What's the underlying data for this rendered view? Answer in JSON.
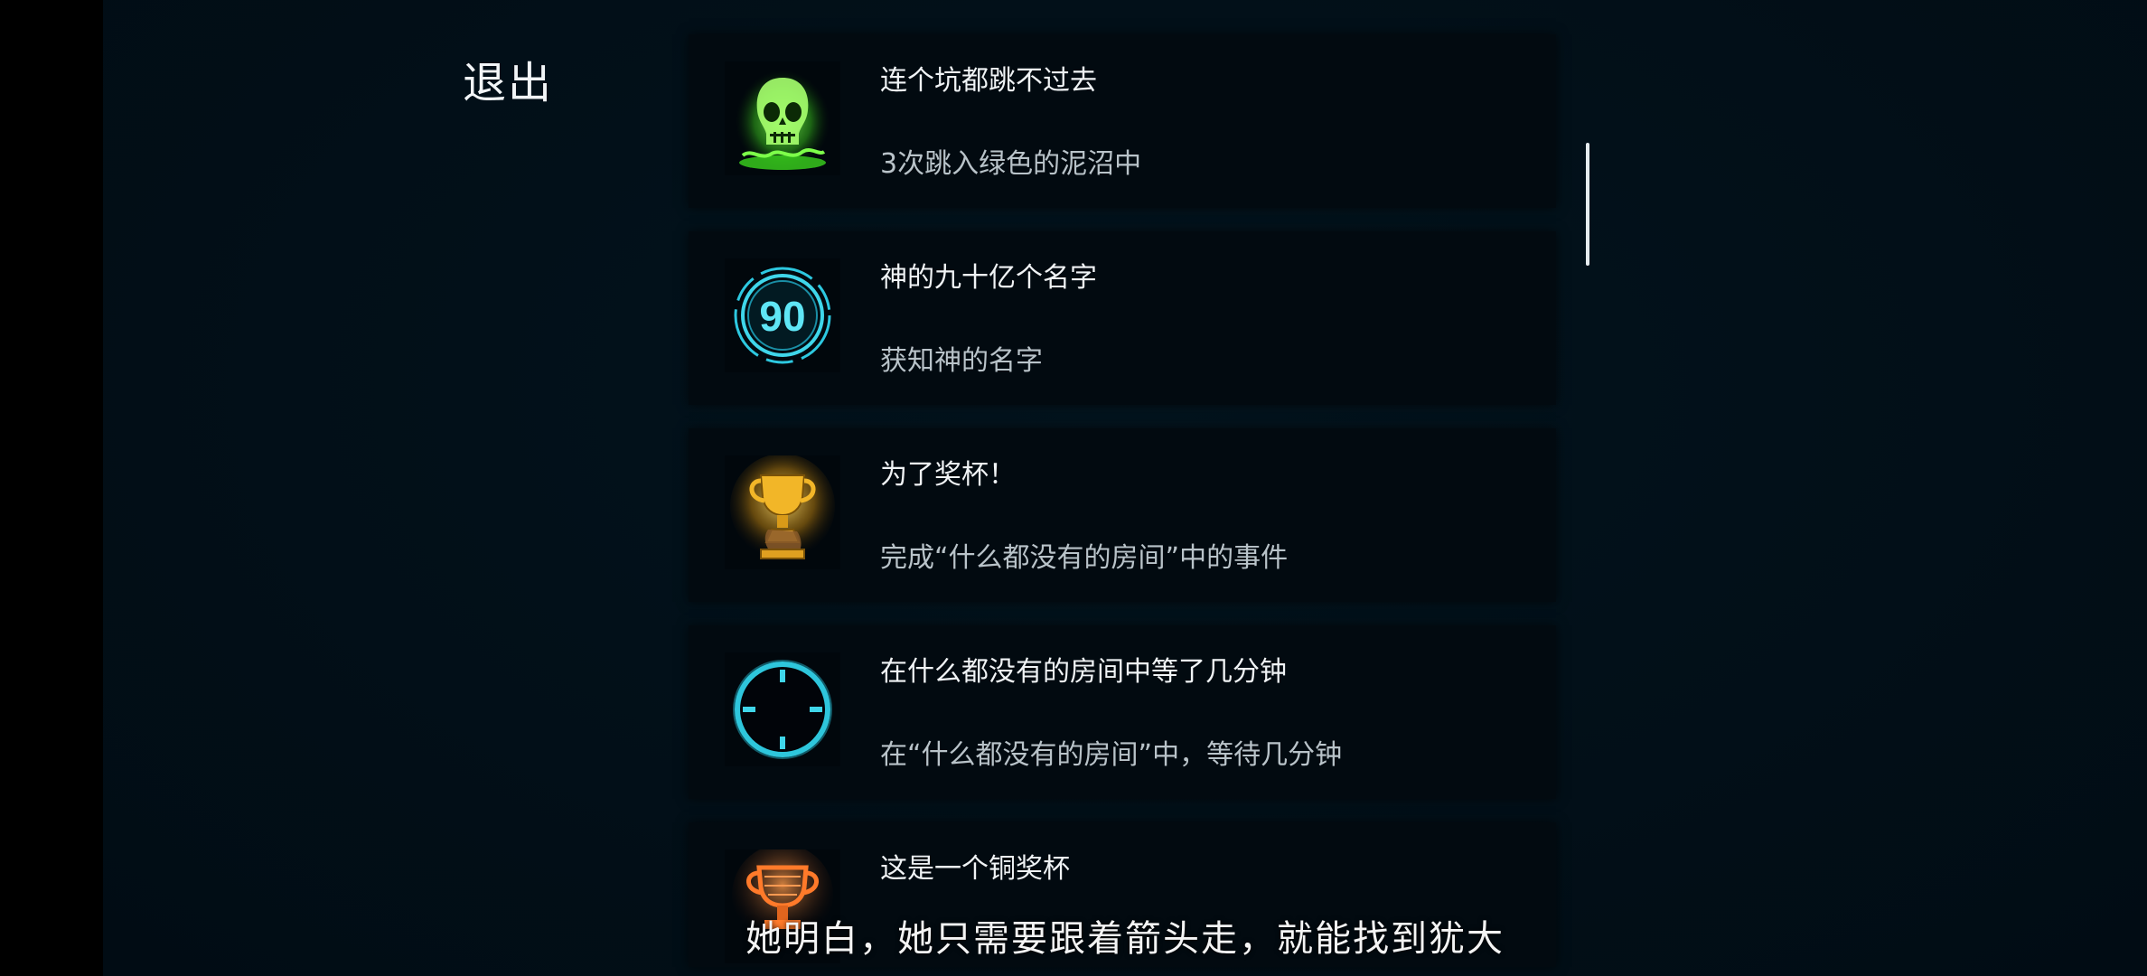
{
  "exit_label": "退出",
  "achievements": [
    {
      "title": "连个坑都跳不过去",
      "description": "3次跳入绿色的泥沼中",
      "icon": "green-skull-icon"
    },
    {
      "title": "神的九十亿个名字",
      "description": "获知神的名字",
      "icon": "number-90-badge-icon",
      "icon_text": "90"
    },
    {
      "title": "为了奖杯！",
      "description": "完成“什么都没有的房间”中的事件",
      "icon": "gold-trophy-hand-icon"
    },
    {
      "title": "在什么都没有的房间中等了几分钟",
      "description": "在“什么都没有的房间”中，等待几分钟",
      "icon": "clock-icon"
    },
    {
      "title": "这是一个铜奖杯",
      "description": "",
      "icon": "bronze-trophy-icon"
    }
  ],
  "subtitle": "她明白，她只需要跟着箭头走，就能找到犹大",
  "colors": {
    "background": "#021019",
    "card": "#020a10",
    "accent_cyan": "#3fd6ea",
    "accent_green": "#5cff3a",
    "accent_gold": "#f2b628",
    "accent_bronze": "#ff7a2a"
  }
}
